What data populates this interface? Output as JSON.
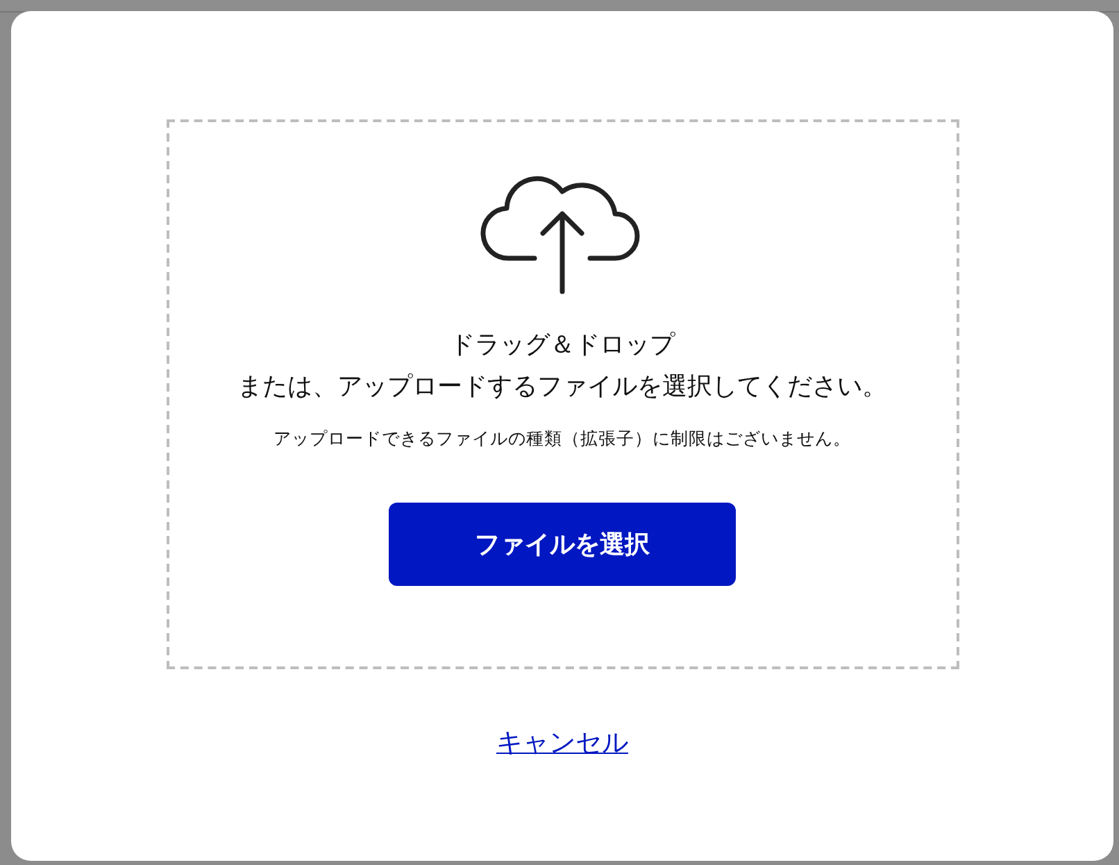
{
  "dialog": {
    "drop_zone": {
      "heading": "ドラッグ＆ドロップ",
      "instruction": "または、アップロードするファイルを選択してください。",
      "note": "アップロードできるファイルの種類（拡張子）に制限はございません。",
      "button": "ファイルを選択"
    },
    "cancel_link": "キャンセル"
  }
}
